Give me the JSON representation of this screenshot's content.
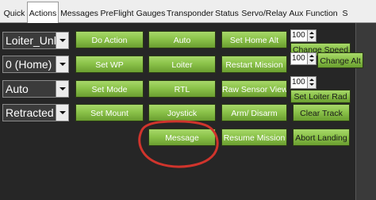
{
  "tabs": [
    {
      "label": "Quick",
      "active": false
    },
    {
      "label": "Actions",
      "active": true
    },
    {
      "label": "Messages",
      "active": false
    },
    {
      "label": "PreFlight",
      "active": false
    },
    {
      "label": "Gauges",
      "active": false
    },
    {
      "label": "Transponder",
      "active": false
    },
    {
      "label": "Status",
      "active": false
    },
    {
      "label": "Servo/Relay",
      "active": false
    },
    {
      "label": "Aux Function",
      "active": false
    },
    {
      "label": "S",
      "active": false
    }
  ],
  "combos": {
    "mode": "Loiter_Unlim",
    "waypoint": "0 (Home)",
    "set_mode": "Auto",
    "mount": "Retracted"
  },
  "buttons": {
    "do_action": "Do Action",
    "auto": "Auto",
    "set_home_alt": "Set Home Alt",
    "set_wp": "Set WP",
    "loiter": "Loiter",
    "restart_mission": "Restart Mission",
    "set_mode": "Set Mode",
    "rtl": "RTL",
    "raw_sensor_view": "Raw Sensor View",
    "set_mount": "Set Mount",
    "joystick": "Joystick",
    "arm_disarm": "Arm/ Disarm",
    "clear_track": "Clear Track",
    "message": "Message",
    "resume_mission": "Resume Mission",
    "abort_landing": "Abort Landing",
    "change_speed": "Change Speed",
    "change_alt": "Change Alt",
    "set_loiter_rad": "Set Loiter Rad"
  },
  "spinners": {
    "speed": "100",
    "alt": "100",
    "loiter_rad": "100"
  },
  "colors": {
    "button_green": "#8bc34a",
    "panel_bg": "#262626",
    "annotation_red": "#d0342c"
  }
}
